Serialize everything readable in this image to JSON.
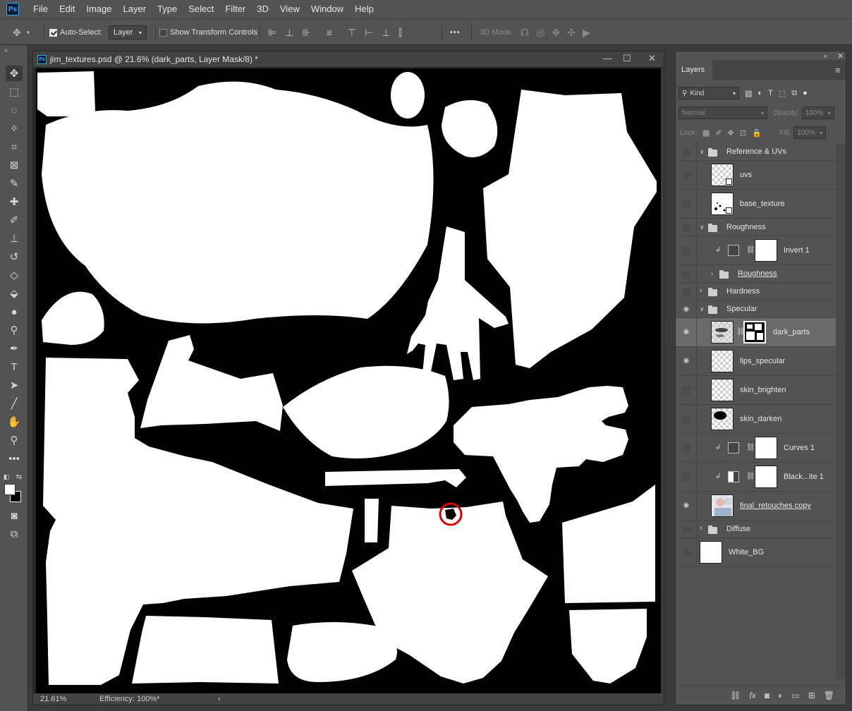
{
  "app": {
    "logo": "Ps"
  },
  "menu": [
    "File",
    "Edit",
    "Image",
    "Layer",
    "Type",
    "Select",
    "Filter",
    "3D",
    "View",
    "Window",
    "Help"
  ],
  "options": {
    "auto_select_label": "Auto-Select:",
    "auto_select_checked": true,
    "auto_select_target": "Layer",
    "transform_controls_label": "Show Transform Controls",
    "transform_controls_checked": false,
    "more_label": "•••",
    "mode_3d_label": "3D Mode:"
  },
  "document": {
    "title": "jim_textures.psd @ 21.6% (dark_parts, Layer Mask/8) *",
    "zoom": "21.61%",
    "efficiency": "Efficiency: 100%*",
    "status_arrow": "›",
    "marker_color": "#e00000"
  },
  "layers_panel": {
    "tab": "Layers",
    "filter_kind": "Kind",
    "blend_mode": "Normal",
    "opacity_label": "Opacity:",
    "opacity_value": "100%",
    "lock_label": "Lock:",
    "fill_label": "Fill:",
    "fill_value": "100%",
    "layers": [
      {
        "name": "Reference & UVs",
        "kind": "group",
        "expanded": true,
        "visible": false
      },
      {
        "name": "uvs",
        "kind": "layer",
        "thumb": "checker-smart",
        "visible": false
      },
      {
        "name": "base_texture",
        "kind": "layer",
        "thumb": "white-smart",
        "visible": false
      },
      {
        "name": "Roughness",
        "kind": "group",
        "expanded": true,
        "visible": false
      },
      {
        "name": "Invert 1",
        "kind": "adjustment",
        "clipped": true,
        "visible": false
      },
      {
        "name": "Roughness",
        "kind": "group",
        "expanded": false,
        "visible": false,
        "underlined": true
      },
      {
        "name": "Hardness",
        "kind": "group",
        "expanded": false,
        "visible": false
      },
      {
        "name": "Specular",
        "kind": "group",
        "expanded": true,
        "visible": true
      },
      {
        "name": "dark_parts",
        "kind": "layer-mask",
        "thumb": "texture",
        "visible": true,
        "selected": true
      },
      {
        "name": "lips_specular",
        "kind": "layer",
        "thumb": "checker",
        "visible": true
      },
      {
        "name": "skin_brighten",
        "kind": "layer",
        "thumb": "checker",
        "visible": false
      },
      {
        "name": "skin_darken",
        "kind": "layer",
        "thumb": "checker-blob",
        "visible": false
      },
      {
        "name": "Curves 1",
        "kind": "adjustment",
        "clipped": true,
        "visible": false
      },
      {
        "name": "Black...ite 1",
        "kind": "adjustment",
        "clipped": true,
        "visible": false
      },
      {
        "name": "final_retouches copy",
        "kind": "layer",
        "thumb": "photo",
        "visible": true,
        "underlined": true
      },
      {
        "name": "Diffuse",
        "kind": "group",
        "expanded": false,
        "visible": false
      },
      {
        "name": "White_BG",
        "kind": "layer",
        "thumb": "white",
        "visible": false
      }
    ],
    "footer_icons": [
      "link-icon",
      "fx-icon",
      "mask-icon",
      "adjustment-icon",
      "folder-icon",
      "new-layer-icon",
      "trash-icon"
    ]
  }
}
